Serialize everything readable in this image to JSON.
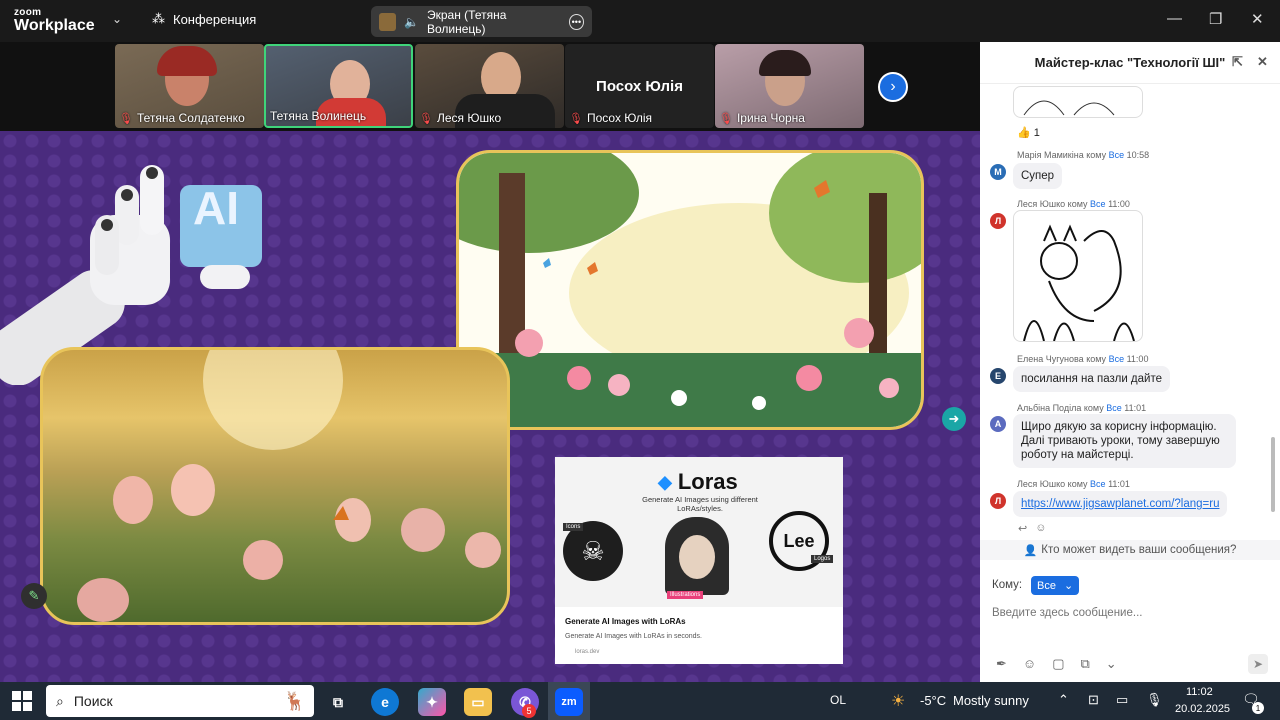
{
  "app": {
    "logo_top": "zoom",
    "logo_bottom": "Workplace"
  },
  "topbar": {
    "meeting_label": "Конференция",
    "screen_share": "Экран (Тетяна Волинець)"
  },
  "participants": [
    {
      "name": "Тетяна Солдатенко",
      "muted": true,
      "active": false
    },
    {
      "name": "Тетяна Волинець",
      "muted": false,
      "active": true
    },
    {
      "name": "Леся Юшко",
      "muted": true,
      "active": false
    },
    {
      "name": "Посох Юлія",
      "muted": true,
      "active": false,
      "video_off": true
    },
    {
      "name": "Ірина Чорна",
      "muted": true,
      "active": false
    }
  ],
  "slide": {
    "ai_badge": "AI",
    "loras": {
      "brand": "Loras",
      "tagline": "Generate AI Images using different LoRAs/styles.",
      "badge_icons": "Icons",
      "badge_illustrations": "Illustrations",
      "badge_logos": "Logos",
      "lee_text": "Lee",
      "title": "Generate AI Images with LoRAs",
      "subtitle": "Generate AI Images with LoRAs in seconds.",
      "domain": "loras.dev"
    }
  },
  "chat": {
    "title": "Майстер-клас \"Технології ШІ\"",
    "reaction": "👍 1",
    "messages": [
      {
        "initial": "М",
        "color": "#2a6db5",
        "author": "Марія Мамикіна",
        "to_word": "кому",
        "to": "Все",
        "time": "10:58",
        "text": "Супер"
      },
      {
        "initial": "Л",
        "color": "#d0342c",
        "author": "Леся Юшко",
        "to_word": "кому",
        "to": "Все",
        "time": "11:00",
        "text": ""
      },
      {
        "initial": "Е",
        "color": "#26466d",
        "author": "Елена Чугунова",
        "to_word": "кому",
        "to": "Все",
        "time": "11:00",
        "text": "посилання на пазли дайте"
      },
      {
        "initial": "А",
        "color": "#5b6bbf",
        "author": "Альбіна Поділа",
        "to_word": "кому",
        "to": "Все",
        "time": "11:01",
        "text": "Щиро дякую за корисну інформацію. Далі тривають уроки, тому завершую роботу на майстерці."
      },
      {
        "initial": "Л",
        "color": "#d0342c",
        "author": "Леся Юшко",
        "to_word": "кому",
        "to": "Все",
        "time": "11:01",
        "text": "https://www.jigsawplanet.com/?lang=ru"
      }
    ],
    "visibility": "Кто может видеть ваши сообщения?",
    "to_label": "Кому:",
    "to_value": "Все",
    "placeholder": "Введите здесь сообщение..."
  },
  "taskbar": {
    "search": "Поиск",
    "badge_count": "5",
    "lang": "OL",
    "temperature": "-5°C",
    "weather": "Mostly sunny",
    "time": "11:02",
    "date": "20.02.2025",
    "notif_count": "1"
  }
}
